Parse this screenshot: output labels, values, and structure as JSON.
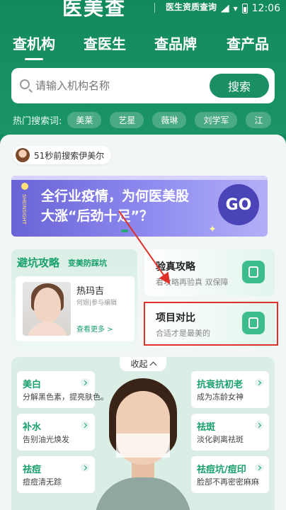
{
  "status_bar": {
    "logo_partial": "医美查",
    "logo_sub": "医生资质查询",
    "time": "12:06"
  },
  "tabs": [
    "查机构",
    "查医生",
    "查品牌",
    "查产品"
  ],
  "search": {
    "placeholder": "请输入机构名称",
    "button": "搜索"
  },
  "hot": {
    "label": "热门搜索词:",
    "chips": [
      "美莱",
      "艺星",
      "薇琳",
      "刘学军",
      "江"
    ]
  },
  "recent_search": "51秒前搜索伊美尔",
  "banner": {
    "line1": "全行业疫情，为何医美股",
    "line2": "大涨“后劲十足”？",
    "side_text": "SHEINSIGHT",
    "go": "GO"
  },
  "guide": {
    "title": "避坑攻略",
    "subtitle": "变美防踩坑",
    "card_title": "热玛吉",
    "card_sub": "何姐|参与编辑",
    "card_more": "查看更多 >"
  },
  "cards": [
    {
      "title": "验真攻略",
      "sub": "看攻略再验真 双保障"
    },
    {
      "title": "项目对比",
      "sub": "合适才是最美的"
    }
  ],
  "faces": {
    "collapse": "收起",
    "left": [
      {
        "title": "美白",
        "sub": "分解黑色素，提亮肤色。"
      },
      {
        "title": "补水",
        "sub": "告别油光焕发"
      },
      {
        "title": "祛痘",
        "sub": "痘痘清无踪"
      }
    ],
    "right": [
      {
        "title": "抗衰抗初老",
        "sub": "成为冻龄女神"
      },
      {
        "title": "祛斑",
        "sub": "淡化剥离祛斑"
      },
      {
        "title": "祛痘坑/痘印",
        "sub": "脸部不再密密麻麻"
      }
    ]
  },
  "colors": {
    "brand_green": "#15895f",
    "accent_green": "#17a06c",
    "banner_purple": "#6a63d6",
    "highlight_red": "#e0302a"
  }
}
